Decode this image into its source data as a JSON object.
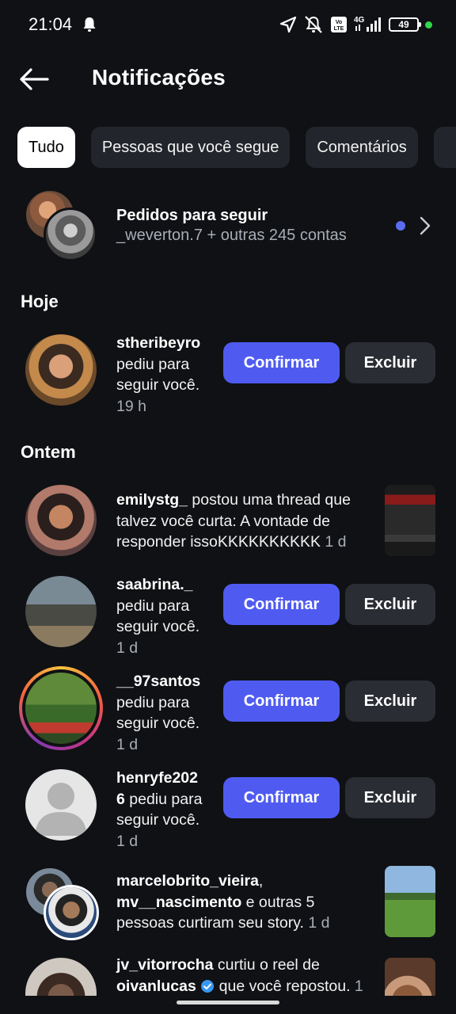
{
  "status_bar": {
    "time": "21:04",
    "battery": "49",
    "network": "4G"
  },
  "header": {
    "title": "Notificações"
  },
  "filters": [
    {
      "label": "Tudo",
      "active": true
    },
    {
      "label": "Pessoas que você segue",
      "active": false
    },
    {
      "label": "Comentários",
      "active": false
    }
  ],
  "follow_requests": {
    "title": "Pedidos para seguir",
    "subtitle": "_weverton.7 + outras 245 contas"
  },
  "sections": {
    "today": "Hoje",
    "yesterday": "Ontem"
  },
  "buttons": {
    "confirm": "Confirmar",
    "delete": "Excluir"
  },
  "notifications": [
    {
      "user": "stheribeyro",
      "line1": "pediu para",
      "line2": "seguir você.",
      "time": "19 h"
    },
    {
      "user": "emilystg_",
      "line1": " postou uma thread que",
      "line2": "talvez você curta: A vontade de",
      "line3": "responder issoKKKKKKKKKK",
      "time": " 1 d"
    },
    {
      "user": "saabrina._",
      "line1": "pediu para",
      "line2": "seguir você.",
      "time": "1 d"
    },
    {
      "user": "__97santos",
      "line1": "pediu para",
      "line2": "seguir você.",
      "time": "1 d"
    },
    {
      "user_a": "henryfe202",
      "user_b": "6",
      "line1": " pediu para",
      "line2": "seguir você.",
      "time": "1 d"
    },
    {
      "user": "marcelobrito_vieira",
      "sep": ",",
      "user2": "mv__nascimento",
      "line1": " e outras 5",
      "line2": "pessoas curtiram seu story.",
      "time": " 1 d"
    },
    {
      "user": "jv_vitorrocha",
      "line1": " curtiu o reel de",
      "user2": "oivanlucas",
      "line2": " que você repostou.",
      "time": " 1"
    }
  ],
  "icons": {
    "back": "arrow-left-icon",
    "bell": "bell-icon",
    "location": "navigation-icon",
    "mute": "bell-off-icon",
    "volte": "volte-icon",
    "signal": "signal-icon",
    "chevron": "chevron-right-icon",
    "verified": "verified-badge-icon"
  },
  "colors": {
    "accent": "#4f5bf0",
    "background": "#0f1114",
    "unread_dot": "#5a6cf0",
    "verified": "#3897f0"
  }
}
